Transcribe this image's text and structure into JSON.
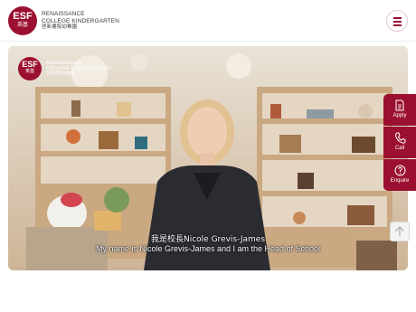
{
  "header": {
    "logo_mark": "ESF",
    "logo_mark_cn": "英基",
    "logo_line1": "RENAISSANCE",
    "logo_line2": "COLLEGE KINDERGARTEN",
    "logo_line3_cn": "啓新書院幼稚園"
  },
  "video": {
    "overlay_logo_mark": "ESF",
    "overlay_logo_mark_cn": "英基",
    "overlay_line1": "RENAISSANCE",
    "overlay_line2": "COLLEGE KINDERGARTEN",
    "overlay_line3_cn": "啓新書院幼稚園",
    "caption_cn": "我是校長Nicole Grevis-James",
    "caption_en": "My name is Nicole Grevis-James and I am the Head of School"
  },
  "side_actions": {
    "apply_label": "Apply",
    "call_label": "Call",
    "enquire_label": "Enquire"
  },
  "colors": {
    "brand": "#9b1030"
  },
  "icons": [
    "menu-icon",
    "document-icon",
    "phone-icon",
    "question-icon",
    "arrow-up-icon"
  ]
}
